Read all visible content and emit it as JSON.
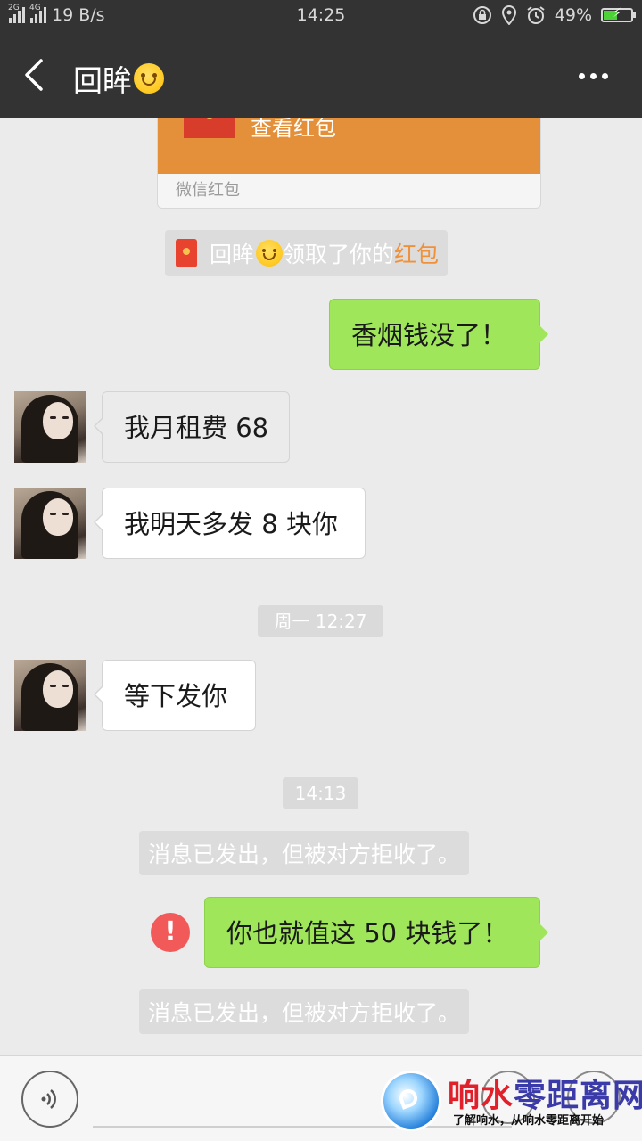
{
  "status_bar": {
    "network_small": "2G",
    "network_4g": "4G",
    "speed": "19 B/s",
    "time": "14:25",
    "battery_percent": "49%",
    "battery_level": 0.49
  },
  "header": {
    "contact_name": "回眸",
    "back_icon": "chevron-left-icon",
    "more_icon": "more-dots-icon"
  },
  "chat": {
    "red_packet": {
      "action_label": "查看红包",
      "footer": "微信红包"
    },
    "red_packet_notice": {
      "name": "回眸",
      "text": "领取了你的",
      "highlight": "红包"
    },
    "messages": [
      {
        "side": "sent",
        "text": "香烟钱没了！"
      },
      {
        "side": "received",
        "text": "我月租费 68"
      },
      {
        "side": "received",
        "text": "我明天多发 8 块你"
      },
      {
        "type": "time",
        "text": "周一 12:27"
      },
      {
        "side": "received",
        "text": "等下发你"
      },
      {
        "type": "time",
        "text": "14:13"
      },
      {
        "type": "system",
        "text": "消息已发出，但被对方拒收了。"
      },
      {
        "side": "sent",
        "text": "你也就值这 50 块钱了！",
        "failed": true,
        "error_icon": "!"
      },
      {
        "type": "system",
        "text": "消息已发出，但被对方拒收了。"
      }
    ]
  },
  "watermark": {
    "title_a": "响水",
    "title_b": "零距离网",
    "subtitle": "了解响水，从响水零距离开始"
  },
  "colors": {
    "bar": "#333333",
    "background": "#ebebeb",
    "sent_bubble": "#9fe65a",
    "red_packet": "#e4903a",
    "error": "#f25a5a"
  }
}
